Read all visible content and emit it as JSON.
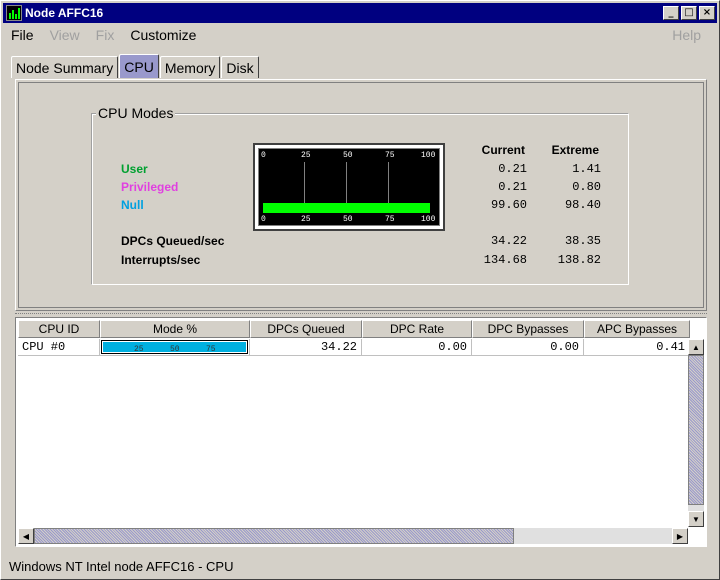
{
  "window": {
    "title": "Node AFFC16",
    "minimize": "_",
    "maximize": "□",
    "close": "×"
  },
  "menu": {
    "file": "File",
    "view": "View",
    "fix": "Fix",
    "customize": "Customize",
    "help": "Help"
  },
  "tabs": [
    "Node Summary",
    "CPU",
    "Memory",
    "Disk"
  ],
  "active_tab": "CPU",
  "cpu_modes": {
    "group_title": "CPU Modes",
    "col_current": "Current",
    "col_extreme": "Extreme",
    "rows": [
      {
        "label": "User",
        "color": "#00a030",
        "current": "0.21",
        "extreme": "1.41"
      },
      {
        "label": "Privileged",
        "color": "#e040e0",
        "current": "0.21",
        "extreme": "0.80"
      },
      {
        "label": "Null",
        "color": "#00a0e0",
        "current": "99.60",
        "extreme": "98.40"
      }
    ],
    "stats": [
      {
        "label": "DPCs Queued/sec",
        "current": "34.22",
        "extreme": "38.35"
      },
      {
        "label": "Interrupts/sec",
        "current": "134.68",
        "extreme": "138.82"
      }
    ],
    "gauge": {
      "ticks": [
        "0",
        "25",
        "50",
        "75",
        "100"
      ],
      "null_level_percent": 99.6
    }
  },
  "table": {
    "headers": [
      "CPU ID",
      "Mode %",
      "DPCs Queued",
      "DPC Rate",
      "DPC Bypasses",
      "APC Bypasses"
    ],
    "rows": [
      {
        "cpu_id": "CPU #0",
        "mode_ticks": [
          "25",
          "50",
          "75"
        ],
        "mode_fill_percent": 99.6,
        "dpcs_queued": "34.22",
        "dpc_rate": "0.00",
        "dpc_bypasses": "0.00",
        "apc_bypasses": "0.41"
      }
    ]
  },
  "status_bar": "Windows NT Intel node AFFC16 - CPU"
}
